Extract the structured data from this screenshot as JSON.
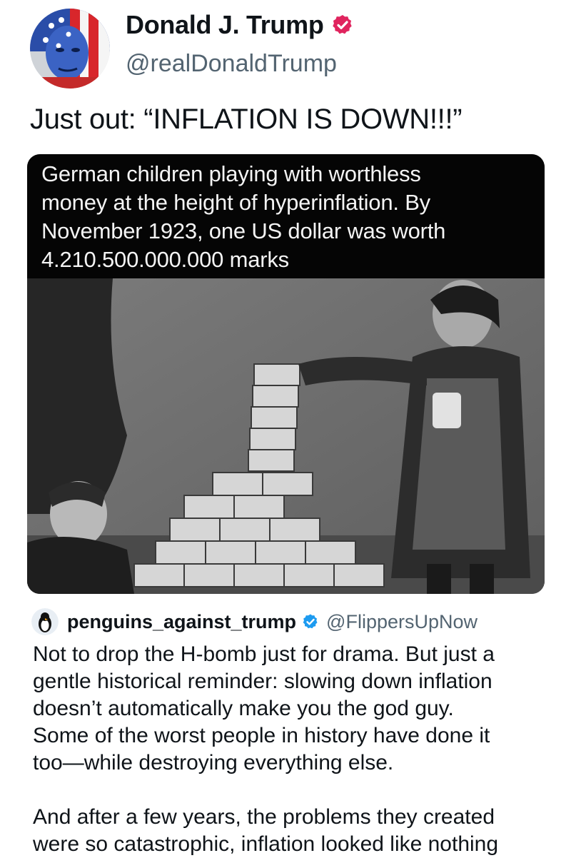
{
  "author": {
    "display_name": "Donald J. Trump",
    "handle": "@realDonaldTrump",
    "verified_color": "#e0245e",
    "avatar_icon": "flag-face-avatar"
  },
  "tweet": {
    "text": "Just out: “INFLATION IS DOWN!!!”"
  },
  "media": {
    "caption_lines": [
      "German children playing with worthless",
      "money at the height of hyperinflation. By",
      "November 1923, one US dollar was worth",
      "4.210.500.000.000 marks"
    ],
    "photo_description_icon": "children-stacking-banknotes-photo"
  },
  "reply": {
    "display_name": "penguins_against_trump",
    "handle": "@FlippersUpNow",
    "verified_color": "#1d9bf0",
    "avatar_icon": "penguin-avatar",
    "lines_p1": [
      "Not to drop the H-bomb just for drama. But just a",
      "gentle historical reminder: slowing down inflation",
      "doesn’t automatically make you the god guy.",
      "Some of the worst people in history have done it",
      "too—while destroying everything else."
    ],
    "lines_p2": [
      "And after a few years, the problems they created",
      "were so catastrophic, inflation looked like nothing"
    ]
  }
}
